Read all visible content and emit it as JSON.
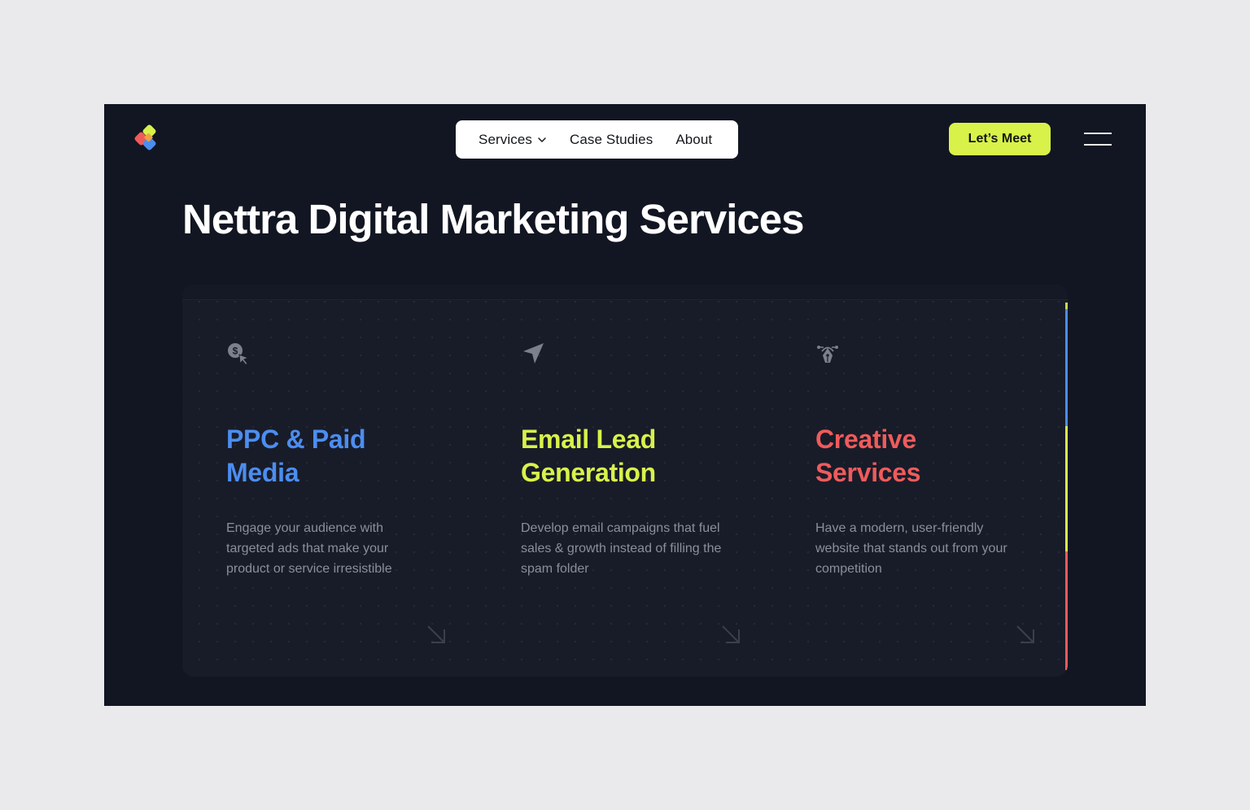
{
  "nav": {
    "items": [
      {
        "label": "Services",
        "has_dropdown": true
      },
      {
        "label": "Case Studies"
      },
      {
        "label": "About"
      }
    ],
    "cta_label": "Let’s Meet"
  },
  "hero": {
    "title": "Nettra Digital Marketing Services"
  },
  "services": [
    {
      "title": "PPC & Paid Media",
      "description": "Engage your audience with targeted ads that make your product or service irresistible",
      "icon": "dollar-cursor-icon",
      "color": "#4c8df0"
    },
    {
      "title": "Email Lead Generation",
      "description": "Develop email campaigns that fuel sales & growth instead of filling the spam folder",
      "icon": "send-arrow-icon",
      "color": "#d8f24a"
    },
    {
      "title": "Creative Services",
      "description": "Have a modern, user-friendly website that stands out from your competition",
      "icon": "pen-nib-icon",
      "color": "#ef5b5b"
    }
  ],
  "colors": {
    "background": "#121622",
    "panel": "#181c29",
    "accent_lime": "#d8f24a",
    "accent_blue": "#4c8df0",
    "accent_red": "#ef5b5b"
  }
}
